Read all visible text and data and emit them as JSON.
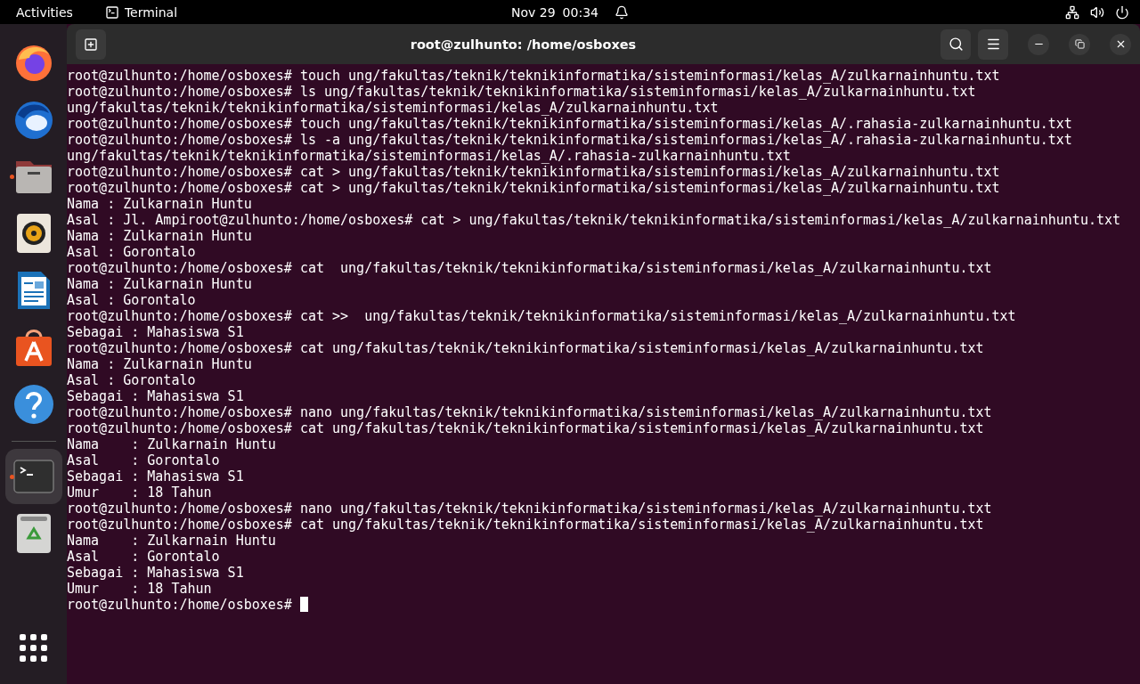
{
  "top_bar": {
    "activities": "Activities",
    "app_name": "Terminal",
    "date": "Nov 29",
    "time": "00:34"
  },
  "dock": {
    "items": [
      {
        "kind": "browser",
        "running": false,
        "selected": false
      },
      {
        "kind": "mail",
        "running": false,
        "selected": false
      },
      {
        "kind": "files",
        "running": true,
        "selected": false
      },
      {
        "kind": "music",
        "running": false,
        "selected": false
      },
      {
        "kind": "writer",
        "running": false,
        "selected": false
      },
      {
        "kind": "store",
        "running": false,
        "selected": false
      },
      {
        "kind": "help",
        "running": false,
        "selected": false
      },
      {
        "kind": "separator"
      },
      {
        "kind": "terminal",
        "running": true,
        "selected": true
      },
      {
        "kind": "trash",
        "running": false,
        "selected": false
      }
    ]
  },
  "window": {
    "title": "root@zulhunto: /home/osboxes"
  },
  "terminal": {
    "lines": [
      "root@zulhunto:/home/osboxes# touch ung/fakultas/teknik/teknikinformatika/sisteminformasi/kelas_A/zulkarnainhuntu.txt",
      "root@zulhunto:/home/osboxes# ls ung/fakultas/teknik/teknikinformatika/sisteminformasi/kelas_A/zulkarnainhuntu.txt",
      "ung/fakultas/teknik/teknikinformatika/sisteminformasi/kelas_A/zulkarnainhuntu.txt",
      "root@zulhunto:/home/osboxes# touch ung/fakultas/teknik/teknikinformatika/sisteminformasi/kelas_A/.rahasia-zulkarnainhuntu.txt",
      "root@zulhunto:/home/osboxes# ls -a ung/fakultas/teknik/teknikinformatika/sisteminformasi/kelas_A/.rahasia-zulkarnainhuntu.txt",
      "ung/fakultas/teknik/teknikinformatika/sisteminformasi/kelas_A/.rahasia-zulkarnainhuntu.txt",
      "root@zulhunto:/home/osboxes# cat > ung/fakultas/teknik/teknikinformatika/sisteminformasi/kelas_A/zulkarnainhuntu.txt",
      "root@zulhunto:/home/osboxes# cat > ung/fakultas/teknik/teknikinformatika/sisteminformasi/kelas_A/zulkarnainhuntu.txt",
      "Nama : Zulkarnain Huntu",
      "Asal : Jl. Ampiroot@zulhunto:/home/osboxes# cat > ung/fakultas/teknik/teknikinformatika/sisteminformasi/kelas_A/zulkarnainhuntu.txt",
      "Nama : Zulkarnain Huntu",
      "Asal : Gorontalo",
      "root@zulhunto:/home/osboxes# cat  ung/fakultas/teknik/teknikinformatika/sisteminformasi/kelas_A/zulkarnainhuntu.txt",
      "Nama : Zulkarnain Huntu",
      "Asal : Gorontalo",
      "root@zulhunto:/home/osboxes# cat >>  ung/fakultas/teknik/teknikinformatika/sisteminformasi/kelas_A/zulkarnainhuntu.txt",
      "Sebagai : Mahasiswa S1",
      "root@zulhunto:/home/osboxes# cat ung/fakultas/teknik/teknikinformatika/sisteminformasi/kelas_A/zulkarnainhuntu.txt",
      "Nama : Zulkarnain Huntu",
      "Asal : Gorontalo",
      "Sebagai : Mahasiswa S1",
      "root@zulhunto:/home/osboxes# nano ung/fakultas/teknik/teknikinformatika/sisteminformasi/kelas_A/zulkarnainhuntu.txt",
      "root@zulhunto:/home/osboxes# cat ung/fakultas/teknik/teknikinformatika/sisteminformasi/kelas_A/zulkarnainhuntu.txt",
      "Nama    : Zulkarnain Huntu",
      "Asal    : Gorontalo",
      "Sebagai : Mahasiswa S1",
      "Umur    : 18 Tahun",
      "root@zulhunto:/home/osboxes# nano ung/fakultas/teknik/teknikinformatika/sisteminformasi/kelas_A/zulkarnainhuntu.txt",
      "root@zulhunto:/home/osboxes# cat ung/fakultas/teknik/teknikinformatika/sisteminformasi/kelas_A/zulkarnainhuntu.txt",
      "Nama    : Zulkarnain Huntu",
      "Asal    : Gorontalo",
      "Sebagai : Mahasiswa S1",
      "Umur    : 18 Tahun"
    ],
    "prompt": "root@zulhunto:/home/osboxes# "
  }
}
